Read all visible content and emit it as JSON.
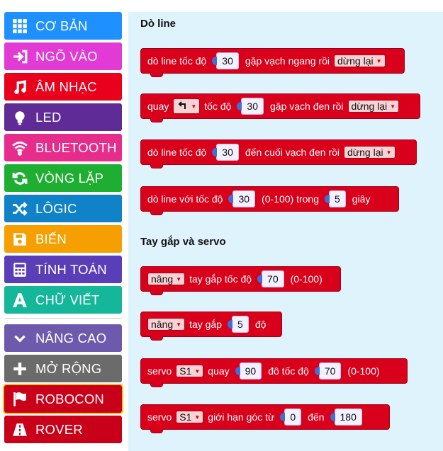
{
  "sidebar": {
    "categories": [
      {
        "label": "CƠ BẢN",
        "color": "#1e90ff",
        "icon": "grid-icon"
      },
      {
        "label": "NGÕ VÀO",
        "color": "#e23ad5",
        "icon": "sign-in-icon"
      },
      {
        "label": "ÂM NHẠC",
        "color": "#e8001c",
        "icon": "music-note-icon"
      },
      {
        "label": "LED",
        "color": "#5e2b97",
        "icon": "lightbulb-icon"
      },
      {
        "label": "BLUETOOTH",
        "color": "#e62d8b",
        "icon": "wifi-icon"
      },
      {
        "label": "VÒNG LẶP",
        "color": "#1eae32",
        "icon": "refresh-icon"
      },
      {
        "label": "LÔGIC",
        "color": "#0f82c8",
        "icon": "shuffle-icon"
      },
      {
        "label": "BIẾN",
        "color": "#f5a000",
        "icon": "save-icon"
      },
      {
        "label": "TÍNH TOÁN",
        "color": "#5a3eb8",
        "icon": "calculator-icon"
      },
      {
        "label": "CHỮ VIẾT",
        "color": "#15b79a",
        "icon": "letter-a-icon"
      },
      {
        "label": "NÂNG CAO",
        "color": "#6e5aad",
        "icon": "chevron-down-icon"
      },
      {
        "label": "MỞ RỘNG",
        "color": "#6b6b6b",
        "icon": "plus-icon"
      },
      {
        "label": "ROBOCON",
        "color": "#c8001a",
        "icon": "flag-icon"
      },
      {
        "label": "ROVER",
        "color": "#c8001a",
        "icon": "road-icon"
      }
    ]
  },
  "workspace": {
    "heading_doline": "Dò line",
    "heading_servo": "Tay gắp và servo",
    "b1": {
      "t1": "dò line tốc độ",
      "v1": "30",
      "t2": "gặp vạch ngang rồi",
      "d1": "dừng lại"
    },
    "b2": {
      "t1": "quay",
      "t2": "tốc độ",
      "v1": "30",
      "t3": "gặp vạch đen rồi",
      "d1": "dừng lại"
    },
    "b3": {
      "t1": "dò line tốc độ",
      "v1": "30",
      "t2": "đến cuối vạch đen rồi",
      "d1": "dừng lại"
    },
    "b4": {
      "t1": "dò line với tốc độ",
      "v1": "30",
      "t2": "(0-100) trong",
      "v2": "5",
      "t3": "giây"
    },
    "b5": {
      "d1": "nâng",
      "t1": "tay gắp tốc độ",
      "v1": "70",
      "t2": "(0-100)"
    },
    "b6": {
      "d1": "nâng",
      "t1": "tay gắp",
      "v1": "5",
      "t2": "độ"
    },
    "b7": {
      "t1": "servo",
      "d1": "S1",
      "t2": "quay",
      "v1": "90",
      "t3": "đô tốc độ",
      "v2": "70",
      "t4": "(0-100)"
    },
    "b8": {
      "t1": "servo",
      "d1": "S1",
      "t2": "giới hạn góc từ",
      "v1": "0",
      "t3": "đến",
      "v2": "180"
    }
  }
}
